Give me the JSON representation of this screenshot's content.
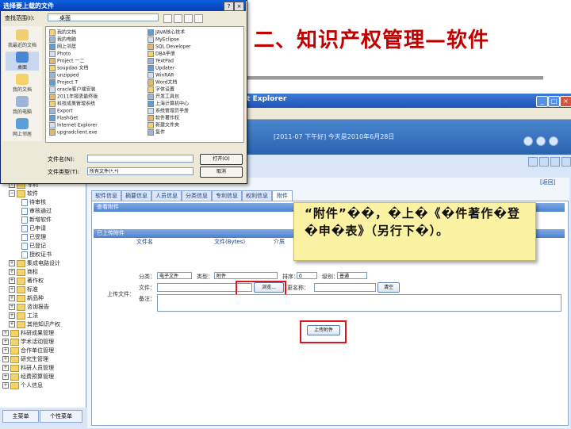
{
  "slide": {
    "title": "二、知识产权管理—软件"
  },
  "app": {
    "window_title": "ot Explorer",
    "header_text": "[2011-07 下午好] 今天是2010年6月28日",
    "top_link": "[返回]"
  },
  "tabs": [
    "软件信息",
    "摘要信息",
    "人员信息",
    "分类信息",
    "专利信息",
    "权利信息",
    "附件"
  ],
  "active_tab": "附件",
  "sections": {
    "attach_title": "查看附件",
    "uploaded_title": "已上传附件",
    "columns": [
      "文件名",
      "文件(Bytes)",
      "介质"
    ]
  },
  "upload_form": {
    "label": "上传文件：",
    "type_label": "分类：",
    "type_value": "电子文件",
    "kind_label": "类型：",
    "kind_value": "附件",
    "order_label": "排序：",
    "order_value": "0",
    "level_label": "级别：",
    "level_value": "普通",
    "file_label": "文件：",
    "browse_label": "浏览...",
    "rename_label": "更名称：",
    "remark_label": "备注：",
    "clear_label": "清空",
    "upload_button": "上传附件"
  },
  "callout": {
    "text": "“附件”��，�上�《�件著作�登�申�表》（另行下�）。"
  },
  "tree": {
    "items": [
      {
        "label": "专利",
        "kind": "folder",
        "indent": 1,
        "exp": "+"
      },
      {
        "label": "软件",
        "kind": "folder",
        "indent": 1,
        "exp": "−"
      },
      {
        "label": "待审核",
        "kind": "page",
        "indent": 3
      },
      {
        "label": "审核通过",
        "kind": "page",
        "indent": 3
      },
      {
        "label": "新增软件",
        "kind": "page",
        "indent": 3
      },
      {
        "label": "已申请",
        "kind": "page",
        "indent": 3
      },
      {
        "label": "已受理",
        "kind": "page",
        "indent": 3
      },
      {
        "label": "已登记",
        "kind": "page",
        "indent": 3
      },
      {
        "label": "授权证书",
        "kind": "page",
        "indent": 3
      },
      {
        "label": "集成电路设计",
        "kind": "folder",
        "indent": 1,
        "exp": "+"
      },
      {
        "label": "商标",
        "kind": "folder",
        "indent": 1,
        "exp": "+"
      },
      {
        "label": "著作权",
        "kind": "folder",
        "indent": 1,
        "exp": "+"
      },
      {
        "label": "标准",
        "kind": "folder",
        "indent": 1,
        "exp": "+"
      },
      {
        "label": "新品种",
        "kind": "folder",
        "indent": 1,
        "exp": "+"
      },
      {
        "label": "咨询报告",
        "kind": "folder",
        "indent": 1,
        "exp": "+"
      },
      {
        "label": "工法",
        "kind": "folder",
        "indent": 1,
        "exp": "+"
      },
      {
        "label": "其他知识产权",
        "kind": "folder",
        "indent": 1,
        "exp": "+"
      },
      {
        "label": "科研成果管理",
        "kind": "folder",
        "indent": 0,
        "exp": "+"
      },
      {
        "label": "学术活动管理",
        "kind": "folder",
        "indent": 0,
        "exp": "+"
      },
      {
        "label": "合作单位管理",
        "kind": "folder",
        "indent": 0,
        "exp": "+"
      },
      {
        "label": "研究生管理",
        "kind": "folder",
        "indent": 0,
        "exp": "+"
      },
      {
        "label": "科研人员管理",
        "kind": "folder",
        "indent": 0,
        "exp": "+"
      },
      {
        "label": "经费预算管理",
        "kind": "folder",
        "indent": 0,
        "exp": "+"
      },
      {
        "label": "个人信息",
        "kind": "folder",
        "indent": 0,
        "exp": "+"
      }
    ],
    "bottom_tabs": [
      "主菜单",
      "个性菜单"
    ]
  },
  "dialog": {
    "title": "选择要上载的文件",
    "lookin_label": "查找范围(I):",
    "lookin_value": "桌面",
    "places": [
      "我最近的文档",
      "桌面",
      "我的文档",
      "我的电脑",
      "网上邻居"
    ],
    "files_left": [
      "我的文档",
      "我的电脑",
      "网上邻居",
      "Photo",
      "Project 一二",
      "soupdao 文档",
      "unzipped",
      "Project T",
      "oracle客户端安装",
      "2011年报表最终版",
      "科技成果管理系统",
      "Export",
      "FlashGet",
      "Internet Explorer",
      "upgradclient.exe"
    ],
    "files_right": [
      "JAVA核心技术",
      "MyEclipse",
      "SQL Developer",
      "DBA手册",
      "TextPad",
      "Updater",
      "WinRAR",
      "Word文档",
      "字体设置",
      "开发工具包",
      "上海计算机中心",
      "系统管理员手册",
      "软件著作权",
      "新建文件夹",
      "复件"
    ],
    "filename_label": "文件名(N):",
    "filetype_label": "文件类型(T):",
    "filetype_value": "所有文件(*.*)",
    "open_button": "打开(O)",
    "cancel_button": "取消"
  },
  "colors": {
    "title_red": "#c00000",
    "highlight_red": "#e2141b",
    "callout_yellow": "#fbf2a4",
    "xp_blue": "#1f54b8"
  }
}
